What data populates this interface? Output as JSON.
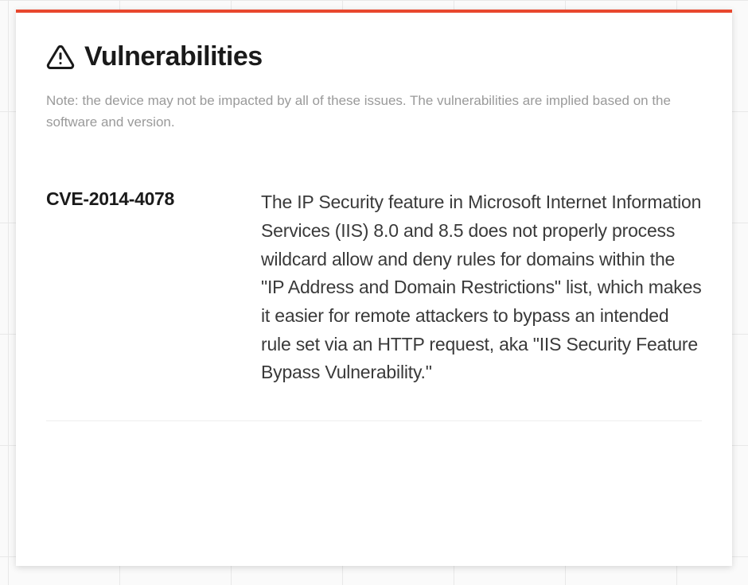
{
  "panel": {
    "title": "Vulnerabilities",
    "note": "Note: the device may not be impacted by all of these issues. The vulnerabilities are implied based on the software and version."
  },
  "vulnerabilities": [
    {
      "id": "CVE-2014-4078",
      "description": "The IP Security feature in Microsoft Internet Information Services (IIS) 8.0 and 8.5 does not properly process wildcard allow and deny rules for domains within the \"IP Address and Domain Restrictions\" list, which makes it easier for remote attackers to bypass an intended rule set via an HTTP request, aka \"IIS Security Feature Bypass Vulnerability.\""
    }
  ]
}
